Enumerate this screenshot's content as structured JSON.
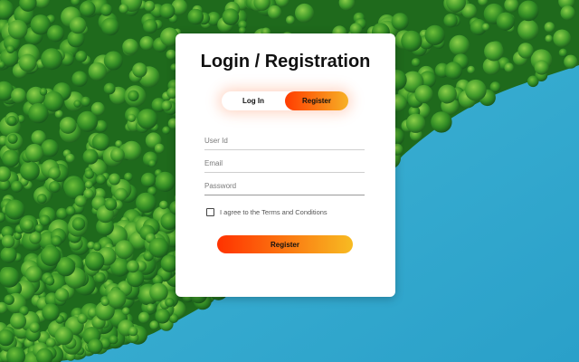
{
  "card": {
    "title": "Login / Registration"
  },
  "toggle": {
    "login_label": "Log In",
    "register_label": "Register",
    "active": "Register"
  },
  "form": {
    "user_id_placeholder": "User Id",
    "email_placeholder": "Email",
    "password_placeholder": "Password",
    "terms_label": "I agree to the Terms and Conditions",
    "terms_checked": false,
    "submit_label": "Register"
  },
  "colors": {
    "gradient_start": "#ff3c00",
    "gradient_end": "#f7b125",
    "water": "#2fa9cf",
    "forest": "#2f7d1f",
    "card": "#ffffff"
  }
}
